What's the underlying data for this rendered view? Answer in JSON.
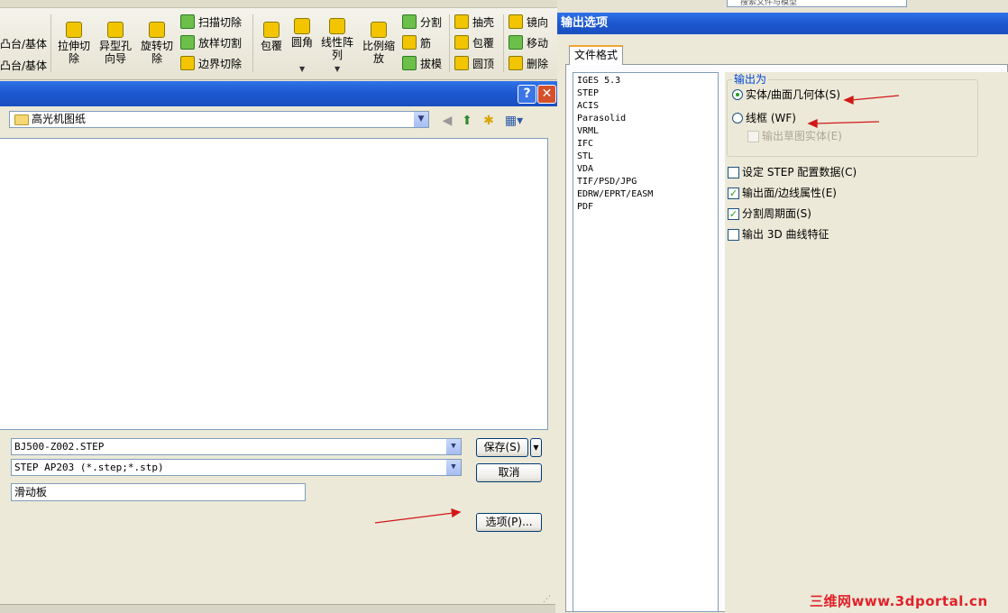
{
  "ribbon": {
    "left_items": [
      "凸台/基体",
      "凸台/基体"
    ],
    "extrude_cut": "拉伸切除",
    "hole_wizard": "异型孔向导",
    "revolve_cut": "旋转切除",
    "swept_cut": "扫描切除",
    "loft_cut": "放样切割",
    "boundary_cut": "边界切除",
    "wrap": "包覆",
    "fillet": "圆角",
    "linear_pattern": "线性阵列",
    "scale": "比例缩放",
    "split": "分割",
    "rib": "筋",
    "draft": "拔模",
    "shell": "抽壳",
    "wrap2": "包覆",
    "dome": "圆顶",
    "mirror": "镜向",
    "move": "移动",
    "delete": "删除"
  },
  "save_dialog": {
    "look_in": "高光机图纸",
    "filename": "BJ500-Z002.STEP",
    "filetype": "STEP AP203 (*.step;*.stp)",
    "description": "滑动板",
    "save_label": "保存(S)",
    "cancel_label": "取消",
    "options_label": "选项(P)..."
  },
  "options_dialog": {
    "title": "输出选项",
    "top_search": "搜索文件与模型",
    "tab_label": "文件格式",
    "formats": [
      "IGES 5.3",
      "STEP",
      "ACIS",
      "Parasolid",
      "VRML",
      "IFC",
      "STL",
      "VDA",
      "TIF/PSD/JPG",
      "EDRW/EPRT/EASM",
      "PDF"
    ],
    "selected_format": "STEP",
    "group_label": "输出为",
    "radio_solid": "实体/曲面几何体(S)",
    "radio_wireframe": "线框 (WF)",
    "chk_sketch": "输出草图实体(E)",
    "chk_step_config": "设定 STEP 配置数据(C)",
    "chk_face_edge": "输出面/边线属性(E)",
    "chk_split_periodic": "分割周期面(S)",
    "chk_3d_curve": "输出 3D 曲线特征"
  },
  "watermark": "三维网www.3dportal.cn",
  "colors": {
    "title_bar": "#1d57d0",
    "annotation_arrow": "#d01818",
    "check_mark": "#21a121"
  }
}
